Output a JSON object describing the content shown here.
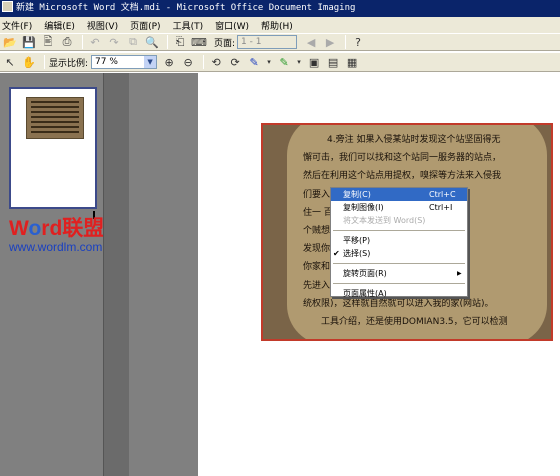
{
  "window": {
    "title": "新建 Microsoft Word 文档.mdi - Microsoft Office Document Imaging"
  },
  "menu": [
    "文件(F)",
    "编辑(E)",
    "视图(V)",
    "页面(P)",
    "工具(T)",
    "窗口(W)",
    "帮助(H)"
  ],
  "toolbar": {
    "page_label": "页面:",
    "page_value": "1 - 1",
    "zoom_label": "显示比例:",
    "zoom_value": "77 %"
  },
  "watermark": {
    "line1_prefix": "W",
    "line1_o": "o",
    "line1_rest": "rd联盟",
    "line2": "www.wordlm.com"
  },
  "document": {
    "lines": [
      "4.旁注 如果入侵某站时发现这个站坚固得无",
      "懈可击，我们可以找和这个站同一服务器的站点，",
      "然后在利用这个站点用提权，嗅探等方法来入侵我",
      "们要入侵的站点。                 比如你和我同",
      "住一                               百岁，现在有",
      "个贼想                             (也就是扫描)",
      "发现你                             这个贼却发现",
      "你家和                             去了，他可以",
      "先进入                             个楼的钥匙(系",
      "统权限)，这样就自然就可以进入我的家(网站)。",
      "工具介绍，还是使用DOMIAN3.5，它可以检测"
    ]
  },
  "context_menu": {
    "items": [
      {
        "label": "复制(C)",
        "shortcut": "Ctrl+C"
      },
      {
        "label": "复制图像(I)",
        "shortcut": "Ctrl+I"
      },
      {
        "label": "将文本发送到 Word(S)",
        "shortcut": ""
      },
      {
        "label": "平移(P)",
        "shortcut": ""
      },
      {
        "label": "选择(S)",
        "shortcut": ""
      },
      {
        "label": "旋转页面(R)",
        "shortcut": ""
      },
      {
        "label": "页面属性(A)",
        "shortcut": ""
      }
    ],
    "checked_mark": "✔",
    "submenu_arrow": "▶"
  }
}
